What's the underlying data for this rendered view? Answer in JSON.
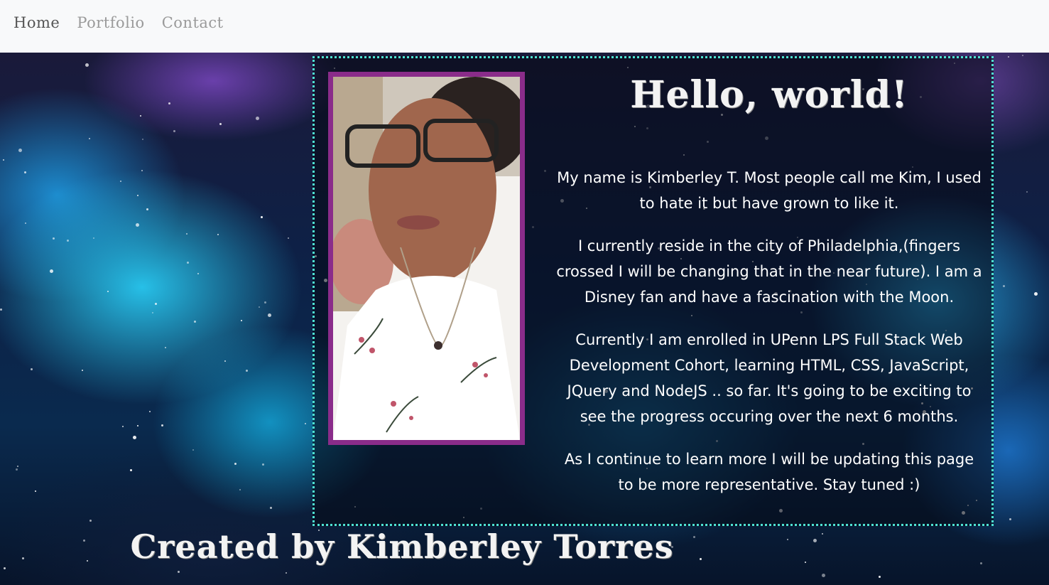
{
  "nav": {
    "items": [
      {
        "label": "Home",
        "active": true
      },
      {
        "label": "Portfolio",
        "active": false
      },
      {
        "label": "Contact",
        "active": false
      }
    ]
  },
  "main": {
    "heading": "Hello, world!",
    "paragraphs": [
      "My name is Kimberley T. Most people call me Kim, I used to hate it but have grown to like it.",
      "I currently reside in the city of Philadelphia,(fingers crossed I will be changing that in the near future). I am a Disney fan and have a fascination with the Moon.",
      "Currently I am enrolled in UPenn LPS Full Stack Web Development Cohort, learning HTML, CSS, JavaScript, JQuery and NodeJS .. so far. It's going to be exciting to see the progress occuring over the next 6 months.",
      "As I continue to learn more I will be updating this page to be more representative. Stay tuned :)"
    ]
  },
  "footer": {
    "credit": "Created by Kimberley Torres"
  },
  "colors": {
    "border_accent": "#4ee2d2",
    "photo_frame": "#8a2c8a",
    "navbar_bg": "#f8f9fa"
  }
}
